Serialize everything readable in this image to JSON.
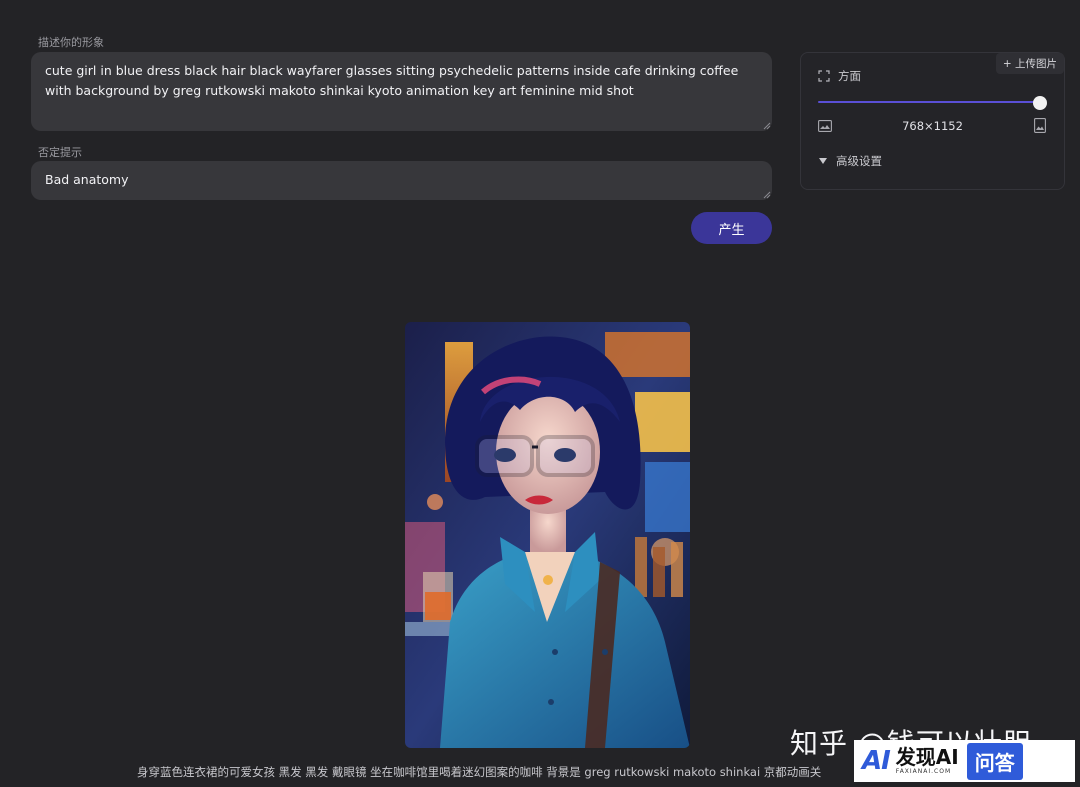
{
  "prompt": {
    "label": "描述你的形象",
    "value": "cute girl in blue dress black hair black wayfarer glasses sitting psychedelic patterns inside cafe drinking coffee with background by greg rutkowski makoto shinkai kyoto animation key art feminine mid shot"
  },
  "negative": {
    "label": "否定提示",
    "value": "Bad anatomy"
  },
  "generate_label": "产生",
  "settings": {
    "upload_label": "+ 上传图片",
    "aspect_label": "方面",
    "aspect_level": 1.0,
    "size_text": "768×1152",
    "advanced_label": "高级设置"
  },
  "result": {
    "caption": "身穿蓝色连衣裙的可爱女孩 黑发 黑发 戴眼镜 坐在咖啡馆里喝着迷幻图案的咖啡 背景是 greg rutkowski makoto shinkai 京都动画关"
  },
  "watermark": {
    "zhihu": "知乎 @钱可以壮胆",
    "badge_logo": "AI",
    "badge_main": "发现AI",
    "badge_sub": "FAXIANAI.COM",
    "badge_qa": "问答"
  },
  "icons": {
    "aspect": "expand-icon",
    "landscape": "image-landscape-icon",
    "portrait": "image-portrait-icon",
    "advanced": "triangle-down-icon"
  },
  "colors": {
    "background": "#232326",
    "field": "#37373b",
    "accent": "#3b3699",
    "slider": "#5a4fd6"
  }
}
